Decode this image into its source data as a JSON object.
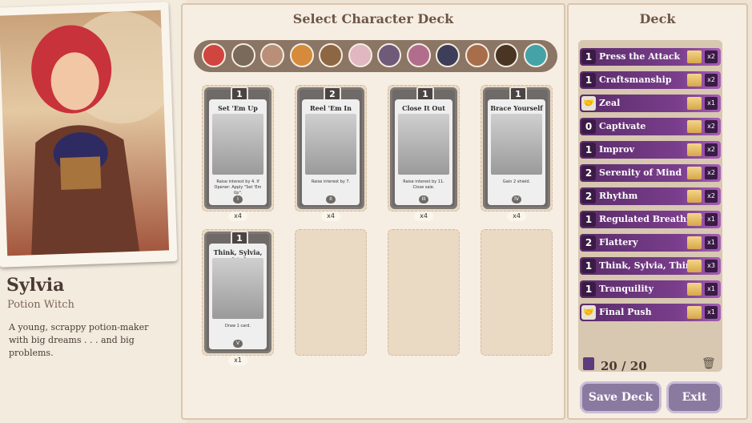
{
  "character": {
    "name": "Sylvia",
    "title": "Potion Witch",
    "description": "A young, scrappy potion-maker with big dreams . . . and big problems."
  },
  "center": {
    "title": "Select Character Deck",
    "face_colors": [
      "#d0453f",
      "#7a6a5b",
      "#b98f78",
      "#d58b3b",
      "#8d6643",
      "#e1b7c2",
      "#6f5a7a",
      "#b36d8c",
      "#3e3e5a",
      "#a86d4a",
      "#4a3525",
      "#44a3a7"
    ],
    "cards": [
      {
        "name": "Set 'Em Up",
        "cost": "1",
        "text": "Raise interest by 4. If Opener: Apply \"Set 'Em Up\".",
        "count": "x4",
        "roman": "I"
      },
      {
        "name": "Reel 'Em In",
        "cost": "2",
        "text": "Raise interest by 7.",
        "count": "x4",
        "roman": "II"
      },
      {
        "name": "Close It Out",
        "cost": "1",
        "text": "Raise interest by 11. Close sale.",
        "count": "x4",
        "roman": "III"
      },
      {
        "name": "Brace Yourself",
        "cost": "1",
        "text": "Gain 2 shield.",
        "count": "x4",
        "roman": "IV"
      },
      {
        "name": "Think, Sylvia, Think",
        "cost": "1",
        "text": "Draw 1 card.",
        "count": "x1",
        "roman": "V"
      }
    ]
  },
  "deck": {
    "title": "Deck",
    "rows": [
      {
        "cost": "1",
        "name": "Press the Attack",
        "qty": "x2"
      },
      {
        "cost": "1",
        "name": "Craftsmanship",
        "qty": "x2"
      },
      {
        "cost": "",
        "name": "Zeal",
        "qty": "x1"
      },
      {
        "cost": "0",
        "name": "Captivate",
        "qty": "x2"
      },
      {
        "cost": "1",
        "name": "Improv",
        "qty": "x2"
      },
      {
        "cost": "2",
        "name": "Serenity of Mind",
        "qty": "x2"
      },
      {
        "cost": "2",
        "name": "Rhythm",
        "qty": "x2"
      },
      {
        "cost": "1",
        "name": "Regulated Breathing",
        "qty": "x1"
      },
      {
        "cost": "2",
        "name": "Flattery",
        "qty": "x1"
      },
      {
        "cost": "1",
        "name": "Think, Sylvia, Think",
        "qty": "x3"
      },
      {
        "cost": "1",
        "name": "Tranquility",
        "qty": "x1"
      },
      {
        "cost": "",
        "name": "Final Push",
        "qty": "x1"
      }
    ],
    "count": "20 / 20"
  },
  "buttons": {
    "save": "Save Deck",
    "exit": "Exit"
  }
}
